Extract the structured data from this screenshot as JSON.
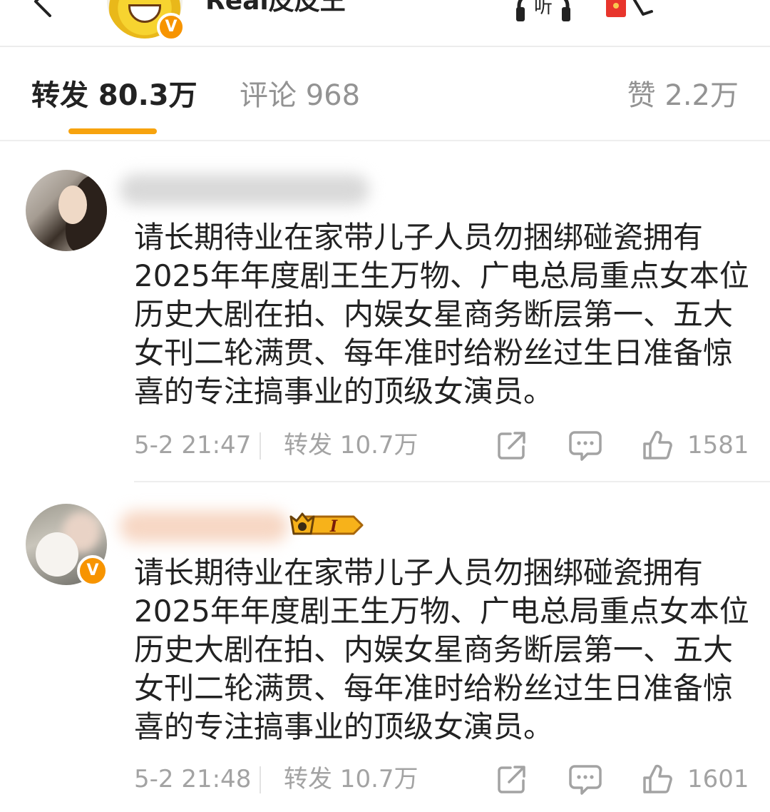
{
  "header": {
    "username": "Real皮皮王",
    "listen_label": "听"
  },
  "tabs": [
    {
      "label": "转发 80.3万",
      "active": true
    },
    {
      "label": "评论 968",
      "active": false
    },
    {
      "label": "赞 2.2万",
      "active": false
    }
  ],
  "colors": {
    "accent": "#f7a30e",
    "verified": "#f79400",
    "muted_text": "#a3a3a3"
  },
  "reposts": [
    {
      "text": "请长期待业在家带儿子人员勿捆绑碰瓷拥有2025年年度剧王生万物、广电总局重点女本位历史大剧在拍、内娱女星商务断层第一、五大女刊二轮满贯、每年准时给粉丝过生日准备惊喜的专注搞事业的顶级女演员。",
      "time": "5-2 21:47",
      "reposts_label": "转发 10.7万",
      "likes": "1581"
    },
    {
      "text": "请长期待业在家带儿子人员勿捆绑碰瓷拥有2025年年度剧王生万物、广电总局重点女本位历史大剧在拍、内娱女星商务断层第一、五大女刊二轮满贯、每年准时给粉丝过生日准备惊喜的专注搞事业的顶级女演员。",
      "time": "5-2 21:48",
      "reposts_label": "转发 10.7万",
      "likes": "1601",
      "level_badge": "I"
    }
  ],
  "icons": {
    "back": "chevron-left-icon",
    "listen": "headphones-icon",
    "redpacket": "red-packet-icon",
    "more": "more-icon",
    "share": "share-icon",
    "comment": "comment-icon",
    "like": "thumbs-up-icon",
    "verified": "verified-v-icon"
  }
}
